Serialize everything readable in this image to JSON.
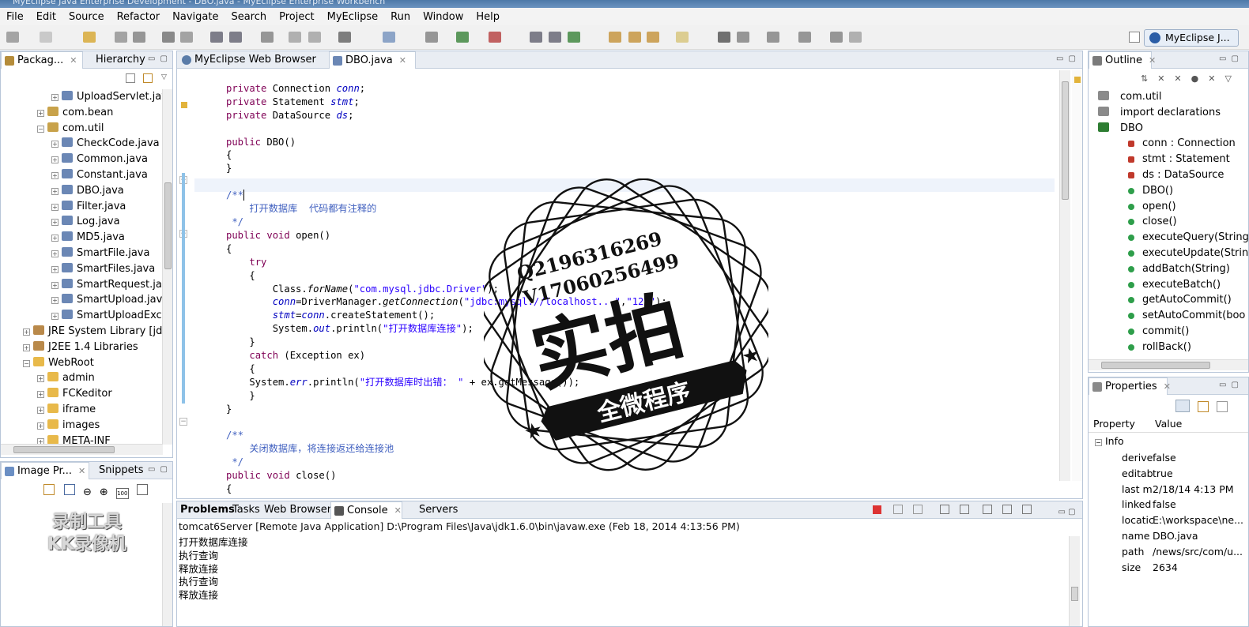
{
  "window": {
    "title": "MyEclipse Java Enterprise Development - DBO.java - MyEclipse Enterprise Workbench"
  },
  "menu": [
    "File",
    "Edit",
    "Source",
    "Refactor",
    "Navigate",
    "Search",
    "Project",
    "MyEclipse",
    "Run",
    "Window",
    "Help"
  ],
  "perspective": {
    "label": "MyEclipse J..."
  },
  "left_panel": {
    "tabs": [
      "Packag...",
      "Hierarchy"
    ],
    "tree": [
      {
        "label": "UploadServlet.jav",
        "level": 3,
        "icon": "java-file-icon"
      },
      {
        "label": "com.bean",
        "level": 2,
        "icon": "package-icon"
      },
      {
        "label": "com.util",
        "level": 2,
        "icon": "package-icon"
      },
      {
        "label": "CheckCode.java",
        "level": 3,
        "icon": "java-file-icon"
      },
      {
        "label": "Common.java",
        "level": 3,
        "icon": "java-file-icon"
      },
      {
        "label": "Constant.java",
        "level": 3,
        "icon": "java-file-icon"
      },
      {
        "label": "DBO.java",
        "level": 3,
        "icon": "java-file-icon"
      },
      {
        "label": "Filter.java",
        "level": 3,
        "icon": "java-file-icon"
      },
      {
        "label": "Log.java",
        "level": 3,
        "icon": "java-file-icon"
      },
      {
        "label": "MD5.java",
        "level": 3,
        "icon": "java-file-icon"
      },
      {
        "label": "SmartFile.java",
        "level": 3,
        "icon": "java-file-icon"
      },
      {
        "label": "SmartFiles.java",
        "level": 3,
        "icon": "java-file-icon"
      },
      {
        "label": "SmartRequest.jav",
        "level": 3,
        "icon": "java-file-icon"
      },
      {
        "label": "SmartUpload.java",
        "level": 3,
        "icon": "java-file-icon"
      },
      {
        "label": "SmartUploadExce",
        "level": 3,
        "icon": "java-file-icon"
      },
      {
        "label": "JRE System Library [jdk1",
        "level": 1,
        "icon": "library-icon"
      },
      {
        "label": "J2EE 1.4 Libraries",
        "level": 1,
        "icon": "library-icon"
      },
      {
        "label": "WebRoot",
        "level": 1,
        "icon": "folder-icon"
      },
      {
        "label": "admin",
        "level": 2,
        "icon": "folder-icon"
      },
      {
        "label": "FCKeditor",
        "level": 2,
        "icon": "folder-icon"
      },
      {
        "label": "iframe",
        "level": 2,
        "icon": "folder-icon"
      },
      {
        "label": "images",
        "level": 2,
        "icon": "folder-icon"
      },
      {
        "label": "META-INF",
        "level": 2,
        "icon": "folder-icon"
      }
    ]
  },
  "image_panel": {
    "tabs": [
      "Image Pr...",
      "Snippets"
    ]
  },
  "editor": {
    "tabs": [
      "MyEclipse Web Browser",
      "DBO.java"
    ],
    "comment_open": "打开数据库  代码都有注释的",
    "comment_close": "关闭数据库，将连接返还给连接池",
    "println_open": "打开数据库连接",
    "println_err": "打开数据库时出错：",
    "driver": "com.mysql.jdbc.Driver",
    "url": "jdbc:mysql://localhost",
    "pwd": "123"
  },
  "bottom_panel": {
    "tabs": [
      "Problems",
      "Tasks",
      "Web Browser",
      "Console",
      "Servers"
    ],
    "console_header": "tomcat6Server [Remote Java Application] D:\\Program Files\\Java\\jdk1.6.0\\bin\\javaw.exe (Feb 18, 2014 4:13:56 PM)",
    "lines": [
      "打开数据库连接",
      "执行查询",
      "释放连接",
      "执行查询",
      "释放连接"
    ]
  },
  "outline": {
    "tab": "Outline",
    "items": [
      {
        "label": "com.util",
        "level": 0,
        "icon": "package-icon"
      },
      {
        "label": "import declarations",
        "level": 0,
        "icon": "import-icon"
      },
      {
        "label": "DBO",
        "level": 0,
        "icon": "class-icon"
      },
      {
        "label": "conn : Connection",
        "level": 1,
        "icon": "field-icon"
      },
      {
        "label": "stmt : Statement",
        "level": 1,
        "icon": "field-icon"
      },
      {
        "label": "ds : DataSource",
        "level": 1,
        "icon": "field-icon"
      },
      {
        "label": "DBO()",
        "level": 1,
        "icon": "constructor-icon"
      },
      {
        "label": "open()",
        "level": 1,
        "icon": "method-icon"
      },
      {
        "label": "close()",
        "level": 1,
        "icon": "method-icon"
      },
      {
        "label": "executeQuery(String",
        "level": 1,
        "icon": "method-icon"
      },
      {
        "label": "executeUpdate(Strin",
        "level": 1,
        "icon": "method-icon"
      },
      {
        "label": "addBatch(String)",
        "level": 1,
        "icon": "method-icon"
      },
      {
        "label": "executeBatch()",
        "level": 1,
        "icon": "method-icon"
      },
      {
        "label": "getAutoCommit()",
        "level": 1,
        "icon": "method-icon"
      },
      {
        "label": "setAutoCommit(boo",
        "level": 1,
        "icon": "method-icon"
      },
      {
        "label": "commit()",
        "level": 1,
        "icon": "method-icon"
      },
      {
        "label": "rollBack()",
        "level": 1,
        "icon": "method-icon"
      }
    ]
  },
  "properties": {
    "tab": "Properties",
    "col_property": "Property",
    "col_value": "Value",
    "group": "Info",
    "rows": [
      {
        "k": "derive",
        "v": "false"
      },
      {
        "k": "editab",
        "v": "true"
      },
      {
        "k": "last m",
        "v": "2/18/14 4:13 PM"
      },
      {
        "k": "linked",
        "v": "false"
      },
      {
        "k": "locatic",
        "v": "E:\\workspace\\ne..."
      },
      {
        "k": "name",
        "v": "DBO.java"
      },
      {
        "k": "path",
        "v": "/news/src/com/u..."
      },
      {
        "k": "size",
        "v": "2634"
      }
    ]
  },
  "stamp": {
    "qq": "Q2196316269",
    "wx": "V17060256499",
    "big": "实拍",
    "ribbon": "全微程序"
  },
  "watermark": {
    "line1": "录制工具",
    "line2": "KK录像机"
  },
  "colors": {
    "keyword": "#7f0055",
    "comment": "#3f5fbf",
    "string": "#2a00ff",
    "field": "#0000c0",
    "folder": "#e8b94a",
    "package": "#c8a24a",
    "java": "#6b87b5",
    "method": "#2e9e4a"
  }
}
